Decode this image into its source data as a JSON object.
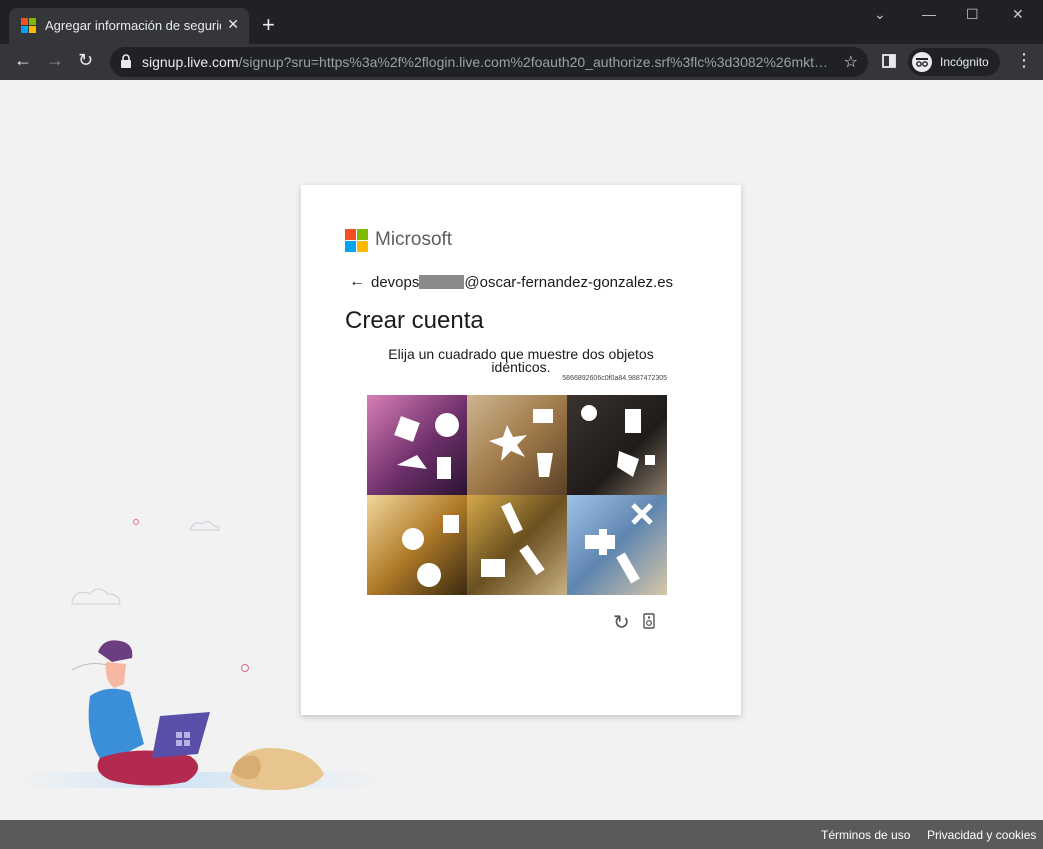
{
  "browser": {
    "tab_title": "Agregar información de seguridad",
    "tab_close": "✕",
    "new_tab": "+",
    "window_controls": {
      "minimize": "—",
      "maximize": "☐",
      "close": "✕",
      "tab_search": "⌄"
    },
    "url_host": "signup.live.com",
    "url_rest": "/signup?sru=https%3a%2f%2flogin.live.com%2foauth20_authorize.srf%3flc%3d3082%26mkt%...",
    "incognito_label": "Incógnito",
    "nav": {
      "back": "←",
      "forward": "→",
      "reload": "↻",
      "star": "☆",
      "menu": "⋮"
    }
  },
  "brand": {
    "name": "Microsoft",
    "colors": [
      "#f25022",
      "#7fba00",
      "#00a4ef",
      "#ffb900"
    ]
  },
  "form": {
    "back_arrow": "←",
    "email_prefix": "devops",
    "email_domain": "@oscar-fernandez-gonzalez.es",
    "title": "Crear cuenta",
    "prompt": "Elija un cuadrado que muestre dos objetos idénticos.",
    "challenge_code": "5866892606c0f0a84.9887472305",
    "controls": {
      "refresh": "↻",
      "audio": "🔊"
    }
  },
  "footer": {
    "terms": "Términos de uso",
    "privacy": "Privacidad y cookies"
  }
}
